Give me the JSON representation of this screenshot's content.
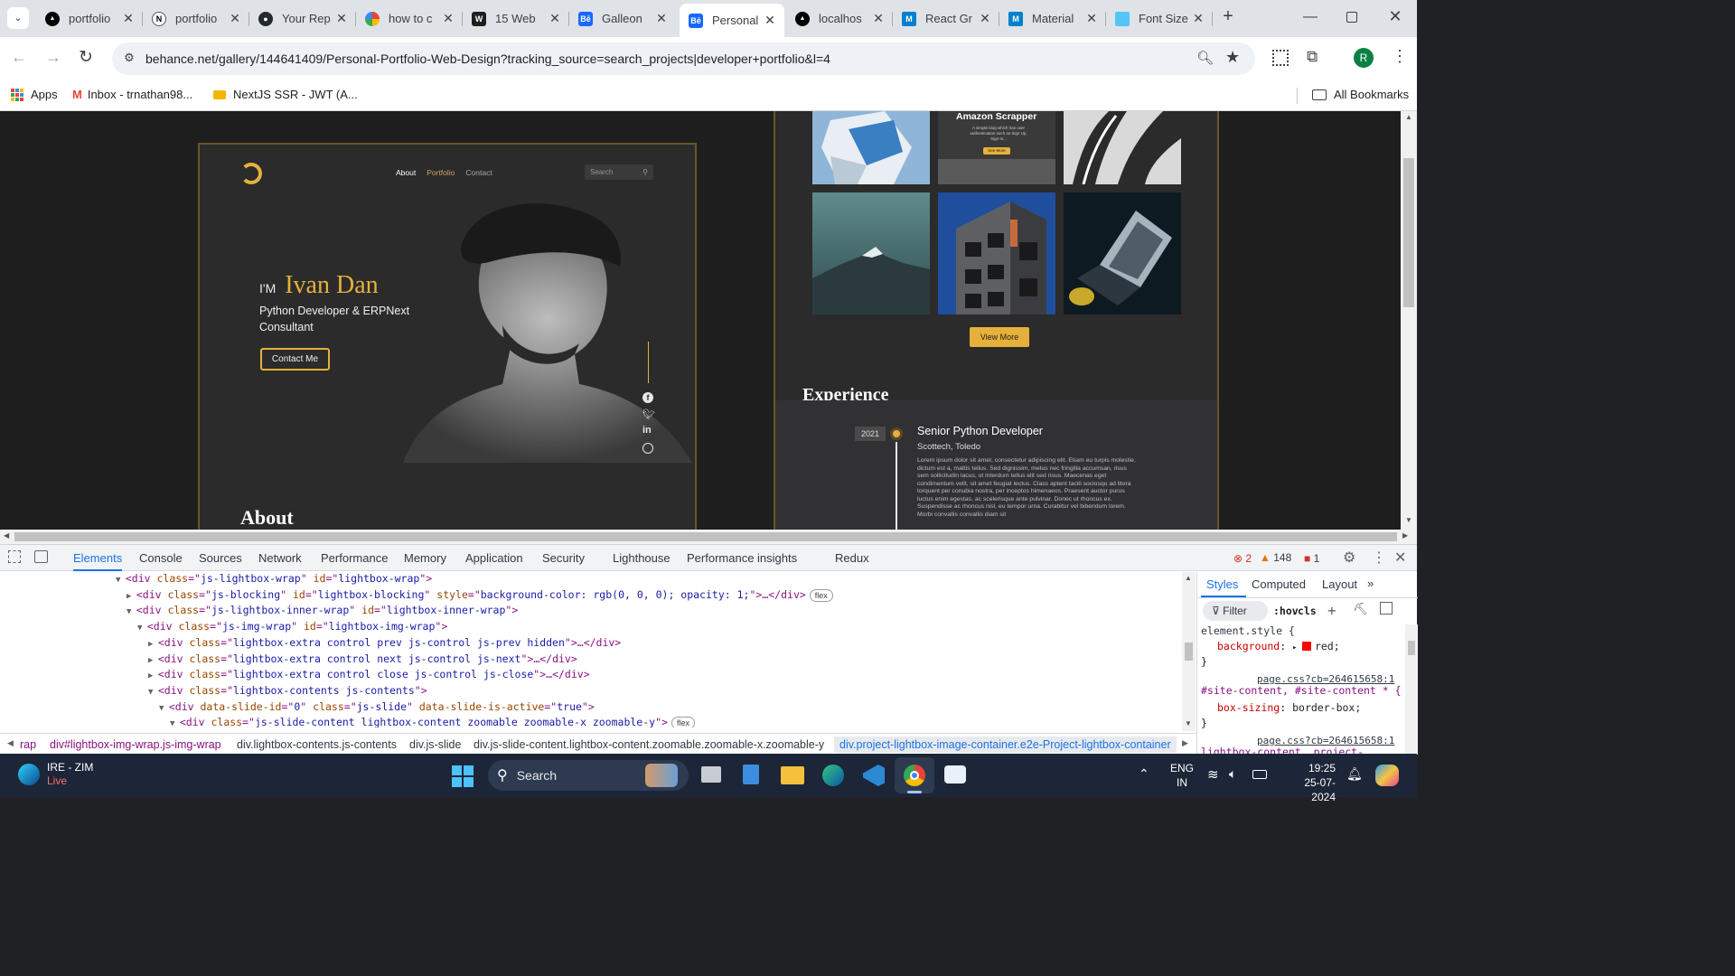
{
  "tabs": [
    {
      "title": "portfolio",
      "icon": "vercel-icon",
      "color": "#000000",
      "active": false
    },
    {
      "title": "portfolio",
      "icon": "notion-icon",
      "color": "#ffffff",
      "active": false
    },
    {
      "title": "Your Rep",
      "icon": "github-icon",
      "color": "#24292f",
      "active": false
    },
    {
      "title": "how to c",
      "icon": "google-icon",
      "color": "#4285f4",
      "active": false
    },
    {
      "title": "15 Web",
      "icon": "webflow-icon",
      "color": "#1f1f1f",
      "active": false
    },
    {
      "title": "Galleon",
      "icon": "behance-icon",
      "color": "#1769ff",
      "active": false
    },
    {
      "title": "Personal",
      "icon": "behance-icon",
      "color": "#1769ff",
      "active": true
    },
    {
      "title": "localhos",
      "icon": "vercel-icon",
      "color": "#000000",
      "active": false
    },
    {
      "title": "React Gr",
      "icon": "mui-icon",
      "color": "#0081cb",
      "active": false
    },
    {
      "title": "Material",
      "icon": "mui-icon",
      "color": "#0081cb",
      "active": false
    },
    {
      "title": "Font Size",
      "icon": "flutter-icon",
      "color": "#54c5f8",
      "active": false
    }
  ],
  "address": {
    "url": "behance.net/gallery/144641409/Personal-Portfolio-Web-Design?tracking_source=search_projects|developer+portfolio&l=4"
  },
  "bookmarks": [
    {
      "label": "Apps",
      "icon": "apps-grid-icon"
    },
    {
      "label": "Inbox - trnathan98...",
      "icon": "gmail-icon"
    },
    {
      "label": "NextJS SSR - JWT (A...",
      "icon": "nextjs-icon"
    }
  ],
  "all_bookmarks": "All Bookmarks",
  "profile_initial": "R",
  "design": {
    "nav": [
      "About",
      "Portfolio",
      "Contact"
    ],
    "search_placeholder": "Search",
    "im": "I'M",
    "name": "Ivan Dan",
    "role": "Python Developer & ERPNext Consultant",
    "cta": "Contact Me",
    "about": "About",
    "amazon_title": "Amazon Scrapper",
    "amazon_sub": "A simple blog which has user authentication such as Sign Up, Sign In...",
    "amazon_btn": "See More",
    "view_more": "View More",
    "experience": "Experience",
    "year": "2021",
    "job_title": "Senior Python Developer",
    "company": "Scottech, Toledo",
    "job_desc": "Lorem ipsum dolor sit amet, consectetur adipiscing elit. Etiam eu turpis molestie, dictum est a, mattis tellus. Sed dignissim, metus nec fringilla accumsan, risus sem sollicitudin lacus, ut interdum tellus elit sed risus. Maecenas eget condimentum velit, sit amet feugiat lectus. Class aptent taciti sociosqu ad litora torquent per conubia nostra, per inceptos himenaeos. Praesent auctor purus luctus enim egestas, ac scelerisque ante pulvinar. Donec ut rhoncus ex. Suspendisse ac rhoncus nisl, eu tempor urna. Curabitur vel bibendum lorem. Morbi convallis convallis diam sit"
  },
  "devtools": {
    "tabs": [
      "Elements",
      "Console",
      "Sources",
      "Network",
      "Performance",
      "Memory",
      "Application",
      "Security",
      "Lighthouse",
      "Performance insights",
      "Redux"
    ],
    "errors": "2",
    "warnings": "148",
    "issues": "1",
    "dom_lines": [
      {
        "arrow": "▼",
        "tag": "div",
        "attrs": [
          [
            "class",
            "js-lightbox-wrap"
          ],
          [
            "id",
            "lightbox-wrap"
          ]
        ],
        "tail": ">",
        "pill": ""
      },
      {
        "arrow": "▶",
        "tag": "div",
        "attrs": [
          [
            "class",
            "js-blocking"
          ],
          [
            "id",
            "lightbox-blocking"
          ],
          [
            "style",
            "background-color: rgb(0, 0, 0); opacity: 1;"
          ]
        ],
        "tail": ">…</div>",
        "pill": "flex"
      },
      {
        "arrow": "▼",
        "tag": "div",
        "attrs": [
          [
            "class",
            "js-lightbox-inner-wrap"
          ],
          [
            "id",
            "lightbox-inner-wrap"
          ]
        ],
        "tail": ">",
        "pill": ""
      },
      {
        "arrow": "▼",
        "tag": "div",
        "attrs": [
          [
            "class",
            "js-img-wrap"
          ],
          [
            "id",
            "lightbox-img-wrap"
          ]
        ],
        "tail": ">",
        "pill": ""
      },
      {
        "arrow": "▶",
        "tag": "div",
        "attrs": [
          [
            "class",
            "lightbox-extra control prev js-control js-prev hidden"
          ]
        ],
        "tail": ">…</div>",
        "pill": ""
      },
      {
        "arrow": "▶",
        "tag": "div",
        "attrs": [
          [
            "class",
            "lightbox-extra control next js-control js-next"
          ]
        ],
        "tail": ">…</div>",
        "pill": ""
      },
      {
        "arrow": "▶",
        "tag": "div",
        "attrs": [
          [
            "class",
            "lightbox-extra control close js-control js-close"
          ]
        ],
        "tail": ">…</div>",
        "pill": ""
      },
      {
        "arrow": "▼",
        "tag": "div",
        "attrs": [
          [
            "class",
            "lightbox-contents js-contents"
          ]
        ],
        "tail": ">",
        "pill": ""
      },
      {
        "arrow": "▼",
        "tag": "div",
        "attrs": [
          [
            "data-slide-id",
            "0"
          ],
          [
            "class",
            "js-slide"
          ],
          [
            "data-slide-is-active",
            "true"
          ]
        ],
        "tail": ">",
        "pill": ""
      },
      {
        "arrow": "▼",
        "tag": "div",
        "attrs": [
          [
            "class",
            "js-slide-content lightbox-content zoomable zoomable-x zoomable-y"
          ]
        ],
        "tail": ">",
        "pill": "flex"
      }
    ],
    "breadcrumbs": [
      "rap",
      "div#lightbox-img-wrap.js-img-wrap",
      "div.lightbox-contents.js-contents",
      "div.js-slide",
      "div.js-slide-content.lightbox-content.zoomable.zoomable-x.zoomable-y",
      "div.project-lightbox-image-container.e2e-Project-lightbox-container"
    ],
    "styles_tabs": [
      "Styles",
      "Computed",
      "Layout"
    ],
    "filter_placeholder": "Filter",
    "hov": ":hov",
    "cls": ".cls",
    "rules": [
      {
        "selector": "element.style {",
        "source": "",
        "prop": "background",
        "val": "red;",
        "swatch": "#ff0000"
      },
      {
        "selector": "#site-content, #site-content * {",
        "source": "page.css?cb=264615658:1",
        "prop": "box-sizing",
        "val": "border-box;",
        "swatch": ""
      },
      {
        "selector": "lightbox-content, project-",
        "source": "page.css?cb=264615658:1",
        "prop": "",
        "val": "",
        "swatch": ""
      }
    ]
  },
  "taskbar": {
    "weather_title": "IRE - ZIM",
    "weather_sub": "Live",
    "search": "Search",
    "lang1": "ENG",
    "lang2": "IN",
    "time": "19:25",
    "date": "25-07-2024"
  }
}
